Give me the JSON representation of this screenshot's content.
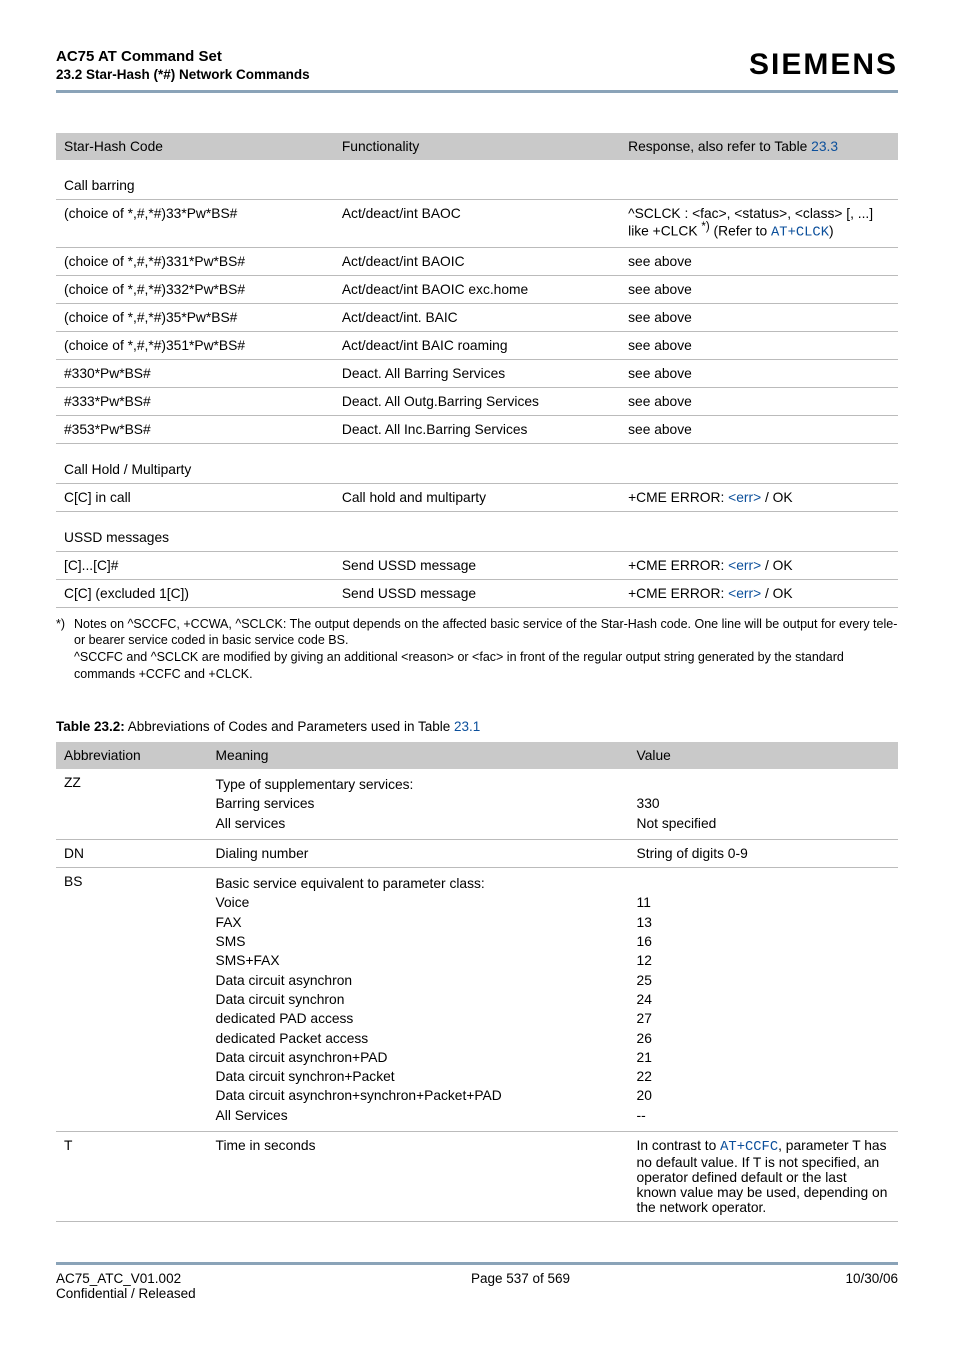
{
  "header": {
    "title": "AC75 AT Command Set",
    "subtitle": "23.2 Star-Hash (*#) Network Commands",
    "brand": "SIEMENS"
  },
  "table1": {
    "headers": [
      "Star-Hash Code",
      "Functionality",
      "Response, also refer to Table "
    ],
    "response_link": "23.3",
    "sections": [
      {
        "title": "Call barring",
        "rows": [
          {
            "c1": "(choice of *,#,*#)33*Pw*BS#",
            "c2": "Act/deact/int BAOC",
            "c3_pre": "^SCLCK : <fac>, <status>, <class> [, ...] like +CLCK ",
            "c3_sup": "*)",
            "c3_mid": " (Refer to ",
            "c3_code": "AT+CLCK",
            "c3_post": ")"
          },
          {
            "c1": "(choice of *,#,*#)331*Pw*BS#",
            "c2": "Act/deact/int BAOIC",
            "c3_plain": "see above"
          },
          {
            "c1": "(choice of *,#,*#)332*Pw*BS#",
            "c2": "Act/deact/int BAOIC exc.home",
            "c3_plain": "see above"
          },
          {
            "c1": "(choice of *,#,*#)35*Pw*BS#",
            "c2": "Act/deact/int. BAIC",
            "c3_plain": "see above"
          },
          {
            "c1": "(choice of *,#,*#)351*Pw*BS#",
            "c2": "Act/deact/int BAIC roaming",
            "c3_plain": "see above"
          },
          {
            "c1": "#330*Pw*BS#",
            "c2": "Deact. All Barring Services",
            "c3_plain": "see above"
          },
          {
            "c1": "#333*Pw*BS#",
            "c2": "Deact. All Outg.Barring Services",
            "c3_plain": "see above"
          },
          {
            "c1": "#353*Pw*BS#",
            "c2": "Deact. All Inc.Barring Services",
            "c3_plain": "see above"
          }
        ]
      },
      {
        "title": "Call Hold / Multiparty",
        "rows": [
          {
            "c1": "C[C] in call",
            "c2": "Call hold and multiparty",
            "c3_cme_pre": "+CME ERROR: ",
            "c3_cme_err": "<err>",
            "c3_cme_post": " / OK"
          }
        ]
      },
      {
        "title": "USSD messages",
        "rows": [
          {
            "c1": "[C]...[C]#",
            "c2": "Send USSD message",
            "c3_cme_pre": "+CME ERROR: ",
            "c3_cme_err": "<err>",
            "c3_cme_post": " / OK"
          },
          {
            "c1": "C[C] (excluded 1[C])",
            "c2": "Send USSD message",
            "c3_cme_pre": "+CME ERROR: ",
            "c3_cme_err": "<err>",
            "c3_cme_post": " / OK"
          }
        ]
      }
    ]
  },
  "star_note": {
    "marker": "*)",
    "body": "Notes on ^SCCFC, +CCWA, ^SCLCK: The output depends on the affected basic service of the Star-Hash code. One line will be output for every tele- or bearer service coded in basic service code BS.\n^SCCFC and ^SCLCK are modified by giving an additional <reason> or <fac> in front of the regular output string generated by the standard commands +CCFC and +CLCK."
  },
  "table2": {
    "caption_bold": "Table 23.2:",
    "caption_rest": "   Abbreviations of Codes and Parameters used in Table ",
    "caption_link": "23.1",
    "headers": [
      "Abbreviation",
      "Meaning",
      "Value"
    ],
    "rows": [
      {
        "abbr": "ZZ",
        "meaning": "Type of supplementary services:\nBarring services\nAll services",
        "value": "\n330\nNot specified"
      },
      {
        "abbr": "DN",
        "meaning": "Dialing number",
        "value": "String of digits 0-9"
      },
      {
        "abbr": "BS",
        "meaning": "Basic service equivalent to parameter class:\nVoice\nFAX\nSMS\nSMS+FAX\nData circuit asynchron\nData circuit synchron\ndedicated PAD access\ndedicated Packet access\nData circuit asynchron+PAD\nData circuit synchron+Packet\nData circuit asynchron+synchron+Packet+PAD\nAll Services",
        "value": "\n11\n13\n16\n12\n25\n24\n27\n26\n21\n22\n20\n--"
      },
      {
        "abbr": "T",
        "meaning": "Time in seconds",
        "value_pre": "In contrast to ",
        "value_code": "AT+CCFC",
        "value_post": ", parameter T has no default value. If T is not specified, an operator defined default or the last known value may be used, depending on the network operator."
      }
    ]
  },
  "footer": {
    "left1": "AC75_ATC_V01.002",
    "left2": "Confidential / Released",
    "center": "Page 537 of 569",
    "right": "10/30/06"
  }
}
